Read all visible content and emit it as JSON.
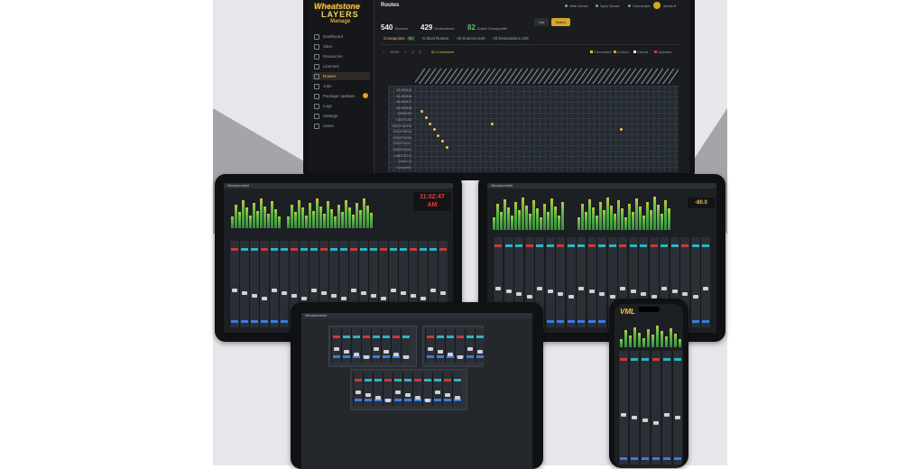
{
  "brand": {
    "line1": "Wheatstone",
    "line2": "LAYERS",
    "line3": "Manage"
  },
  "monitor": {
    "sidebar": [
      {
        "label": "Dashboard"
      },
      {
        "label": "Sites"
      },
      {
        "label": "Resources"
      },
      {
        "label": "Licenses"
      },
      {
        "label": "Routes",
        "active": true
      },
      {
        "label": "Jobs"
      },
      {
        "label": "Package Updates",
        "badge": true
      },
      {
        "label": "Logs"
      },
      {
        "label": "Settings"
      },
      {
        "label": "Users"
      }
    ],
    "title": "Routes",
    "topbar": {
      "items": [
        "Web Server",
        "Sync Server",
        "Connected"
      ],
      "user": "admin"
    },
    "stats": {
      "sources": "540",
      "sources_label": "Sources",
      "destinations": "429",
      "destinations_label": "Destinations",
      "active": "82",
      "active_label": "Active Crosspoints"
    },
    "view_toggle": {
      "list": "List",
      "matrix": "Matrix"
    },
    "tabs": [
      {
        "label": "Crosspoints",
        "count": "82",
        "active": true
      },
      {
        "label": "Critical Routes"
      },
      {
        "label": "All Sources",
        "count": "540"
      },
      {
        "label": "All Destinations",
        "count": "429"
      }
    ],
    "toolbar": {
      "zoom": "100%",
      "connected": "82 Connected",
      "legend": [
        {
          "label": "Connected",
          "color": "#e0c23a"
        },
        {
          "label": "Locked",
          "color": "#e0a020"
        },
        {
          "label": "Critical",
          "color": "#e8e8e8"
        },
        {
          "label": "Updated",
          "color": "#d04040"
        }
      ]
    },
    "row_labels": [
      "BL950D5",
      "BL950D6",
      "BL950D7",
      "BL950D8",
      "CBDIOR",
      "CBDTLIB",
      "CBDYNDPA",
      "CBDP000A",
      "CBDP000B",
      "CBDP000C",
      "CBDP000D",
      "CBDTDTO",
      "ChaTr.O",
      "Console1"
    ]
  },
  "tablet_left": {
    "appbar": "WheatstoneNet",
    "clock_time": "11:02:47",
    "clock_ampm": "AM"
  },
  "tablet_right": {
    "appbar": "WheatstoneNet",
    "level": "-80.0"
  },
  "tablet_center": {
    "appbar": "WheatstoneNet"
  },
  "phone": {
    "logo": "VML"
  }
}
